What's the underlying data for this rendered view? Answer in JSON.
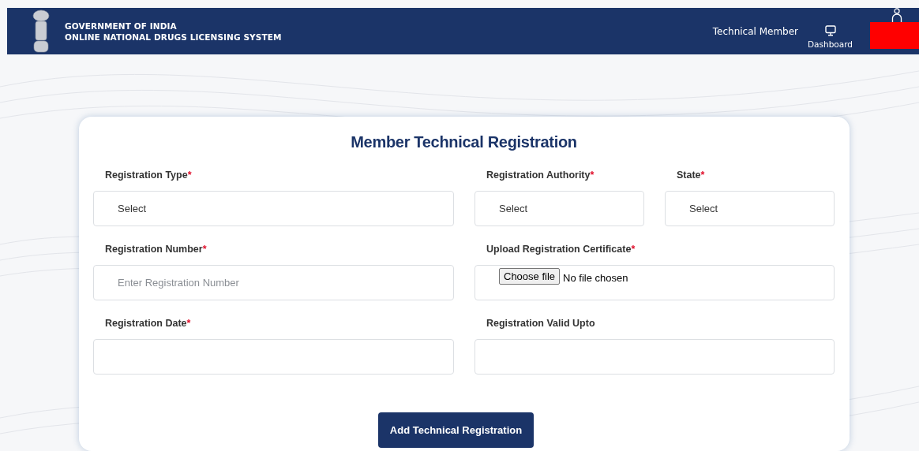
{
  "header": {
    "title_line_1": "GOVERNMENT OF INDIA",
    "title_line_2": "ONLINE NATIONAL DRUGS LICENSING SYSTEM",
    "role": "Technical Member",
    "nav": [
      {
        "kind": "dashboard",
        "label": "Dashboard"
      },
      {
        "kind": "user"
      }
    ]
  },
  "form": {
    "title": "Member Technical Registration",
    "rows": [
      [
        {
          "kind": "select",
          "label": "Registration Type",
          "required_mark": "*",
          "value": "Select"
        },
        {
          "kind": "select",
          "label": "Registration Authority",
          "required_mark": "*",
          "value": "Select"
        },
        {
          "kind": "select",
          "label": "State",
          "required_mark": "*",
          "value": "Select"
        }
      ],
      [
        {
          "kind": "text",
          "label": "Registration Number",
          "required_mark": "*",
          "placeholder": "Enter Registration Number"
        },
        {
          "kind": "file",
          "label": "Upload Registration Certificate",
          "required_mark": "*",
          "button": "Choose file",
          "status": "No file chosen"
        }
      ],
      [
        {
          "kind": "text",
          "label": "Registration Date",
          "required_mark": "*"
        },
        {
          "kind": "text",
          "label": "Registration Valid Upto"
        }
      ]
    ],
    "submit": "Add Technical Registration"
  }
}
